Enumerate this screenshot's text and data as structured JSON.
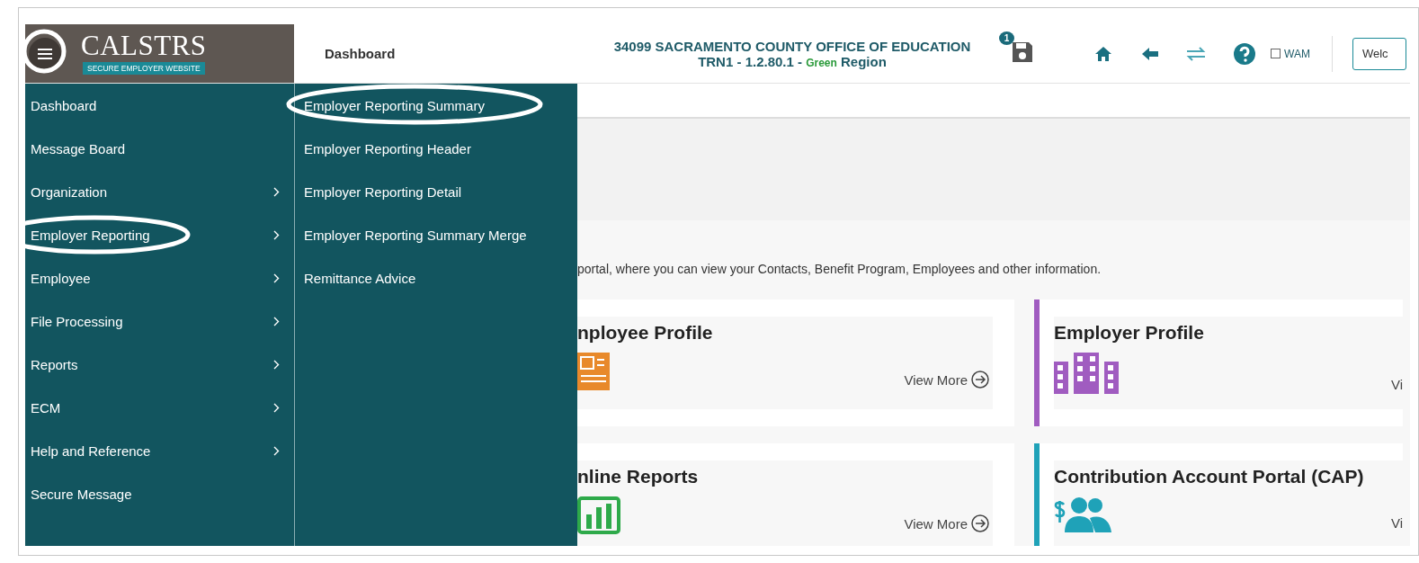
{
  "header": {
    "menu_button": {
      "circled": true
    },
    "logo": {
      "name": "CALSTRS",
      "tagline": "SECURE EMPLOYER WEBSITE"
    },
    "page_title": "Dashboard",
    "organization": "34099 SACRAMENTO COUNTY OFFICE OF EDUCATION",
    "environment": {
      "prefix": "TRN1 - 1.2.80.1 - ",
      "highlight": "Green",
      "suffix": "Region"
    },
    "save_badge": "1",
    "wam": {
      "label": "WAM",
      "checked": false
    },
    "welcome_button": "Welc"
  },
  "menu": [
    {
      "label": "Dashboard",
      "has_submenu": false,
      "circled": false
    },
    {
      "label": "Message Board",
      "has_submenu": false,
      "circled": false
    },
    {
      "label": "Organization",
      "has_submenu": true,
      "circled": false
    },
    {
      "label": "Employer Reporting",
      "has_submenu": true,
      "circled": true
    },
    {
      "label": "Employee",
      "has_submenu": true,
      "circled": false
    },
    {
      "label": "File Processing",
      "has_submenu": true,
      "circled": false
    },
    {
      "label": "Reports",
      "has_submenu": true,
      "circled": false
    },
    {
      "label": "ECM",
      "has_submenu": true,
      "circled": false
    },
    {
      "label": "Help and Reference",
      "has_submenu": true,
      "circled": false
    },
    {
      "label": "Secure Message",
      "has_submenu": false,
      "circled": false
    }
  ],
  "submenu": [
    {
      "label": "Employer Reporting Summary",
      "circled": true
    },
    {
      "label": "Employer Reporting Header",
      "circled": false
    },
    {
      "label": "Employer Reporting Detail",
      "circled": false
    },
    {
      "label": "Employer Reporting Summary Merge",
      "circled": false
    },
    {
      "label": "Remittance Advice",
      "circled": false
    }
  ],
  "description": "portal, where you can view your Contacts, Benefit Program, Employees and other information.",
  "cards": [
    {
      "title": "nployee Profile",
      "kind": "id-card",
      "color": "#e8892b",
      "accent": false,
      "link": "View More"
    },
    {
      "title": "Employer Profile",
      "kind": "building",
      "color": "#a05cc0",
      "accent": true,
      "link": "Vi"
    },
    {
      "title": "nline Reports",
      "kind": "chart",
      "color": "#2eaa4a",
      "accent": false,
      "link": "View More"
    },
    {
      "title": "Contribution Account Portal (CAP)",
      "kind": "people",
      "color": "#1fa2b8",
      "accent": true,
      "link": "Vi"
    }
  ]
}
